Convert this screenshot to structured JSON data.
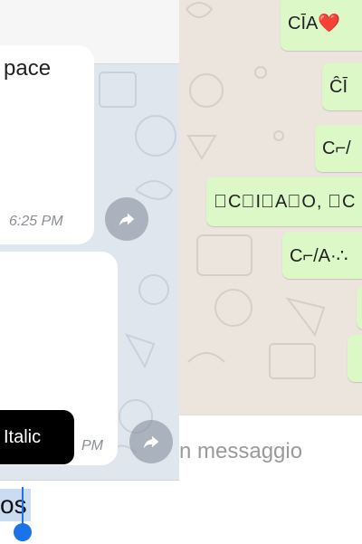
{
  "left": {
    "bubble1_text": "pace",
    "bubble1_time": "6:25 PM",
    "bubble2_time": "PM",
    "tooltip": "Italic",
    "selected_text": "os"
  },
  "right": {
    "messages": [
      "CĪA❤️",
      "ĈĪ",
      "C⌐/",
      "⃞C⃞I⃞A⃞O, ⃞C",
      "C⌐/A·∴"
    ],
    "input_placeholder": "n messaggio"
  },
  "icons": {
    "share": "share-arrow-icon",
    "doodle": "chat-doodle-background"
  },
  "colors": {
    "telegram_bg": "#dfe6ee",
    "whatsapp_bg": "#ece5dd",
    "outgoing_bubble": "#dcf8c6",
    "selection": "#cbdcf2",
    "caret": "#1a73e8"
  }
}
